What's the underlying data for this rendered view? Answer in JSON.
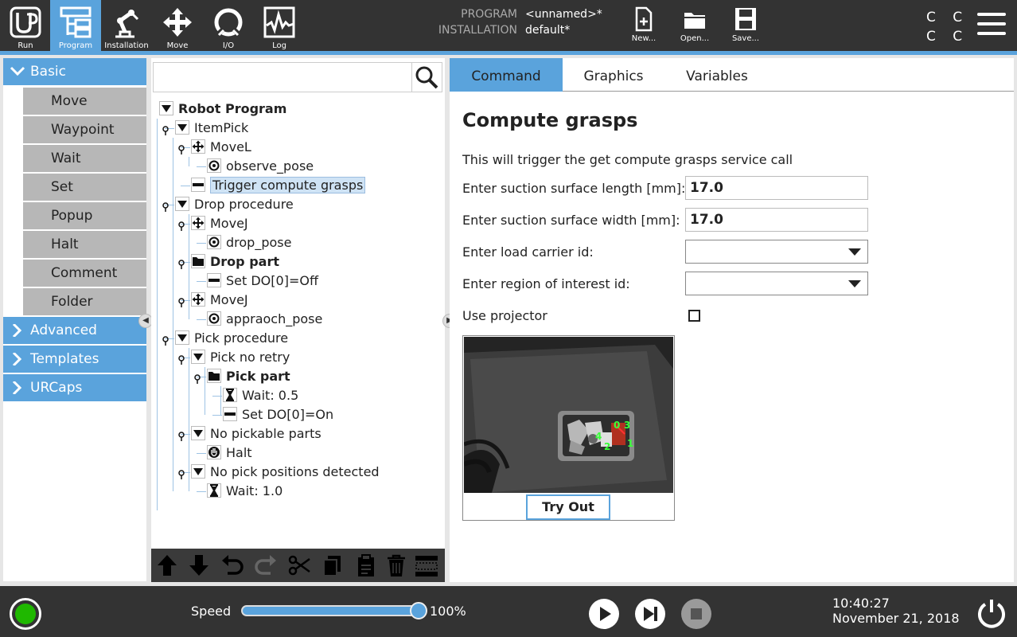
{
  "topbar": {
    "nav": [
      {
        "label": "Run",
        "icon": "ur-logo-icon"
      },
      {
        "label": "Program",
        "icon": "program-icon",
        "active": true
      },
      {
        "label": "Installation",
        "icon": "robot-arm-icon"
      },
      {
        "label": "Move",
        "icon": "move-arrows-icon"
      },
      {
        "label": "I/O",
        "icon": "io-icon"
      },
      {
        "label": "Log",
        "icon": "log-waveform-icon"
      }
    ],
    "program_key": "PROGRAM",
    "program_value": "<unnamed>*",
    "installation_key": "INSTALLATION",
    "installation_value": "default*",
    "file_buttons": [
      {
        "label": "New...",
        "icon": "new-file-icon"
      },
      {
        "label": "Open...",
        "icon": "folder-open-icon"
      },
      {
        "label": "Save...",
        "icon": "save-icon"
      }
    ],
    "cc_line1": "C C",
    "cc_line2": "C C"
  },
  "sidebar": {
    "basic_label": "Basic",
    "basic_items": [
      "Move",
      "Waypoint",
      "Wait",
      "Set",
      "Popup",
      "Halt",
      "Comment",
      "Folder"
    ],
    "categories": [
      "Advanced",
      "Templates",
      "URCaps"
    ]
  },
  "tree": {
    "search_placeholder": "",
    "nodes": [
      {
        "label": "Robot Program",
        "icon": "triangle-down-icon",
        "bold": true
      },
      {
        "label": "ItemPick",
        "icon": "triangle-down-icon"
      },
      {
        "label": "MoveL",
        "icon": "move-arrows-icon"
      },
      {
        "label": "observe_pose",
        "icon": "waypoint-icon"
      },
      {
        "label": "Trigger compute grasps",
        "icon": "set-icon",
        "selected": true
      },
      {
        "label": "Drop procedure",
        "icon": "triangle-down-icon"
      },
      {
        "label": "MoveJ",
        "icon": "move-arrows-icon"
      },
      {
        "label": "drop_pose",
        "icon": "waypoint-icon"
      },
      {
        "label": "Drop part",
        "icon": "folder-icon",
        "bold": true
      },
      {
        "label": "Set DO[0]=Off",
        "icon": "set-icon"
      },
      {
        "label": "MoveJ",
        "icon": "move-arrows-icon"
      },
      {
        "label": "appraoch_pose",
        "icon": "waypoint-icon"
      },
      {
        "label": "Pick procedure",
        "icon": "triangle-down-icon"
      },
      {
        "label": "Pick no retry",
        "icon": "triangle-down-icon"
      },
      {
        "label": "Pick part",
        "icon": "folder-icon",
        "bold": true
      },
      {
        "label": "Wait: 0.5",
        "icon": "hourglass-icon"
      },
      {
        "label": "Set DO[0]=On",
        "icon": "set-icon"
      },
      {
        "label": "No pickable parts",
        "icon": "triangle-down-icon"
      },
      {
        "label": "Halt",
        "icon": "halt-hand-icon"
      },
      {
        "label": "No pick positions detected",
        "icon": "triangle-down-icon"
      },
      {
        "label": "Wait: 1.0",
        "icon": "hourglass-icon"
      }
    ],
    "toolbar": [
      "move-up-icon",
      "move-down-icon",
      "undo-icon",
      "redo-icon",
      "cut-icon",
      "copy-icon",
      "paste-icon",
      "delete-icon",
      "suppress-icon"
    ]
  },
  "panel": {
    "tabs": [
      "Command",
      "Graphics",
      "Variables"
    ],
    "active_tab": "Command",
    "title": "Compute grasps",
    "description": "This will trigger the get compute grasps service call",
    "length_label": "Enter suction surface length [mm]:",
    "length_value": "17.0",
    "width_label": "Enter suction surface width [mm]:",
    "width_value": "17.0",
    "load_carrier_label": "Enter load carrier id:",
    "load_carrier_value": "",
    "roi_label": "Enter region of interest id:",
    "roi_value": "",
    "projector_label": "Use projector",
    "projector_checked": false,
    "grasp_labels": [
      "0",
      "3",
      "4",
      "2",
      "1"
    ],
    "tryout_label": "Try Out"
  },
  "bottombar": {
    "status_color": "#1fb800",
    "speed_label": "Speed",
    "speed_value": "100%",
    "speed_fraction": 1.0,
    "time": "10:40:27",
    "date": "November 21, 2018"
  },
  "colors": {
    "accent": "#5aa3dc",
    "bar": "#333333",
    "basic_item": "#b7b7b7"
  }
}
